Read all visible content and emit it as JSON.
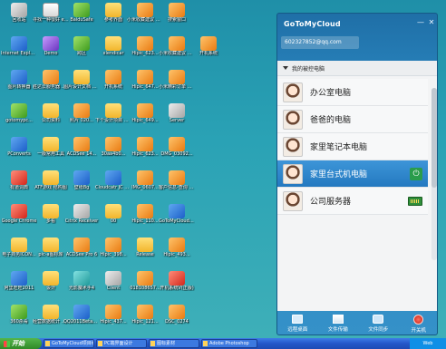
{
  "desktop_icons": [
    {
      "label": "回收站",
      "icon": "recycle-bin-icon",
      "color": "g-grey"
    },
    {
      "label": "寻找一种很好 eee9500修复",
      "icon": "document-icon",
      "color": "g-doc"
    },
    {
      "label": "BaiduSafe",
      "icon": "shield-icon",
      "color": "g-green"
    },
    {
      "label": "参考界面",
      "icon": "folder-icon",
      "color": "g-folder"
    },
    {
      "label": "小米收藏建议 人项目",
      "icon": "app-icon",
      "color": "g-orange"
    },
    {
      "label": "搜索窗口",
      "icon": "app-icon",
      "color": "g-orange"
    },
    {
      "label": "Internet Explorer",
      "icon": "ie-icon",
      "color": "g-blue"
    },
    {
      "label": "Demo",
      "icon": "app-icon",
      "color": "g-purple"
    },
    {
      "label": "跨区",
      "icon": "app-icon",
      "color": "g-green"
    },
    {
      "label": "xlendicar",
      "icon": "folder-icon",
      "color": "g-folder"
    },
    {
      "label": "Hipic_623...",
      "icon": "image-icon",
      "color": "g-orange"
    },
    {
      "label": "小米收藏建议 界面优化",
      "icon": "app-icon",
      "color": "g-orange"
    },
    {
      "label": "开机系统",
      "icon": "app-icon",
      "color": "g-orange"
    },
    {
      "label": "图片转换器",
      "icon": "app-icon",
      "color": "g-blue"
    },
    {
      "label": "胜达云服务器 Web管理平台",
      "icon": "app-icon",
      "color": "g-orange"
    },
    {
      "label": "图片设计文档 宣传资料",
      "icon": "folder-icon",
      "color": "g-folder"
    },
    {
      "label": "开机系统",
      "icon": "app-icon",
      "color": "g-orange"
    },
    {
      "label": "Hipic_647...",
      "icon": "image-icon",
      "color": "g-orange"
    },
    {
      "label": "小米精彩订单 国际收获",
      "icon": "app-icon",
      "color": "g-orange"
    },
    {
      "label": "gotomypc...",
      "icon": "app-icon",
      "color": "g-green"
    },
    {
      "label": "公司资料",
      "icon": "folder-icon",
      "color": "g-folder"
    },
    {
      "label": "照片 020...",
      "icon": "image-icon",
      "color": "g-orange"
    },
    {
      "label": "下个设计项目 你可以联系",
      "icon": "folder-icon",
      "color": "g-folder"
    },
    {
      "label": "Hipic_649...",
      "icon": "image-icon",
      "color": "g-orange"
    },
    {
      "label": "Server",
      "icon": "app-icon",
      "color": "g-grey"
    },
    {
      "label": "PConverts",
      "icon": "app-icon",
      "color": "g-blue"
    },
    {
      "label": "一版常用工具",
      "icon": "folder-icon",
      "color": "g-folder"
    },
    {
      "label": "ACDSee 14...",
      "icon": "app-icon",
      "color": "g-orange"
    },
    {
      "label": "30aa4b0...",
      "icon": "image-icon",
      "color": "g-orange"
    },
    {
      "label": "Hipic_623...",
      "icon": "image-icon",
      "color": "g-orange"
    },
    {
      "label": "DMG_03092...",
      "icon": "image-icon",
      "color": "g-orange"
    },
    {
      "label": "有道词典",
      "icon": "app-icon",
      "color": "g-red"
    },
    {
      "label": "ATF游戏 结构图",
      "icon": "folder-icon",
      "color": "g-folder"
    },
    {
      "label": "壁纸Bg",
      "icon": "app-icon",
      "color": "g-blue"
    },
    {
      "label": "Cloudcatr JC 说明文档",
      "icon": "app-icon",
      "color": "g-blue"
    },
    {
      "label": "IMG_0607...",
      "icon": "image-icon",
      "color": "g-orange"
    },
    {
      "label": "客户信息-查询 2000...",
      "icon": "image-icon",
      "color": "g-orange"
    },
    {
      "label": "Google Chrome",
      "icon": "chrome-icon",
      "color": "g-red"
    },
    {
      "label": "多看",
      "icon": "folder-icon",
      "color": "g-folder"
    },
    {
      "label": "Citrix Receiver",
      "icon": "app-icon",
      "color": "g-grey"
    },
    {
      "label": "00",
      "icon": "folder-icon",
      "color": "g-folder"
    },
    {
      "label": "Hipic_110...",
      "icon": "image-icon",
      "color": "g-orange"
    },
    {
      "label": "GoToMyCloud 主控端",
      "icon": "app-icon",
      "color": "g-blue"
    },
    {
      "label": "电子商务ICON...",
      "icon": "folder-icon",
      "color": "g-folder"
    },
    {
      "label": "pic-a图标库",
      "icon": "folder-icon",
      "color": "g-folder"
    },
    {
      "label": "ACDSee Pro 6",
      "icon": "app-icon",
      "color": "g-orange"
    },
    {
      "label": "Hipic_398...",
      "icon": "image-icon",
      "color": "g-orange"
    },
    {
      "label": "Release",
      "icon": "folder-icon",
      "color": "g-folder"
    },
    {
      "label": "Hipic_493...",
      "icon": "image-icon",
      "color": "g-orange"
    },
    {
      "label": "阿里旺旺2011",
      "icon": "app-icon",
      "color": "g-blue"
    },
    {
      "label": "设计",
      "icon": "folder-icon",
      "color": "g-folder"
    },
    {
      "label": "光影魔术手4",
      "icon": "app-icon",
      "color": "g-teal"
    },
    {
      "label": "Client",
      "icon": "app-icon",
      "color": "g-grey"
    },
    {
      "label": "018108657...",
      "icon": "image-icon",
      "color": "g-orange"
    },
    {
      "label": "开机系统V(正版)",
      "icon": "app-icon",
      "color": "g-red"
    },
    {
      "label": "360杀毒",
      "icon": "app-icon",
      "color": "g-green"
    },
    {
      "label": "经营数据统计 和研发规划",
      "icon": "folder-icon",
      "color": "g-folder"
    },
    {
      "label": "QQ2011Beta2 开发版本",
      "icon": "app-icon",
      "color": "g-blue"
    },
    {
      "label": "Hipic_437...",
      "icon": "image-icon",
      "color": "g-orange"
    },
    {
      "label": "Hipic_121...",
      "icon": "image-icon",
      "color": "g-orange"
    },
    {
      "label": "DSC_0274",
      "icon": "image-icon",
      "color": "g-orange"
    }
  ],
  "taskbar": {
    "start_label": "开始",
    "tasks": [
      "GoToMyCloud项目组",
      "PC端界面设计",
      "图标素材",
      "Adobe Photoshop"
    ],
    "tray": "Web"
  },
  "app": {
    "title": "GoToMyCloud",
    "account": "602327852@qq.com",
    "list_header": "我的被控电脑",
    "devices": [
      {
        "name": "办公室电脑",
        "status": ""
      },
      {
        "name": "爸爸的电脑",
        "status": ""
      },
      {
        "name": "家里笔记本电脑",
        "status": ""
      },
      {
        "name": "家里台式机电脑",
        "status": "power"
      },
      {
        "name": "公司服务器",
        "status": "server"
      }
    ],
    "tools": [
      {
        "label": "远程桌面",
        "icon": "remote-desktop-icon"
      },
      {
        "label": "文件传输",
        "icon": "file-transfer-icon"
      },
      {
        "label": "文件同步",
        "icon": "file-sync-icon"
      },
      {
        "label": "开关机",
        "icon": "power-icon"
      }
    ],
    "colors": {
      "accent": "#2479c0",
      "header": "#1f6fa7",
      "power": "#2a9c4b"
    }
  }
}
